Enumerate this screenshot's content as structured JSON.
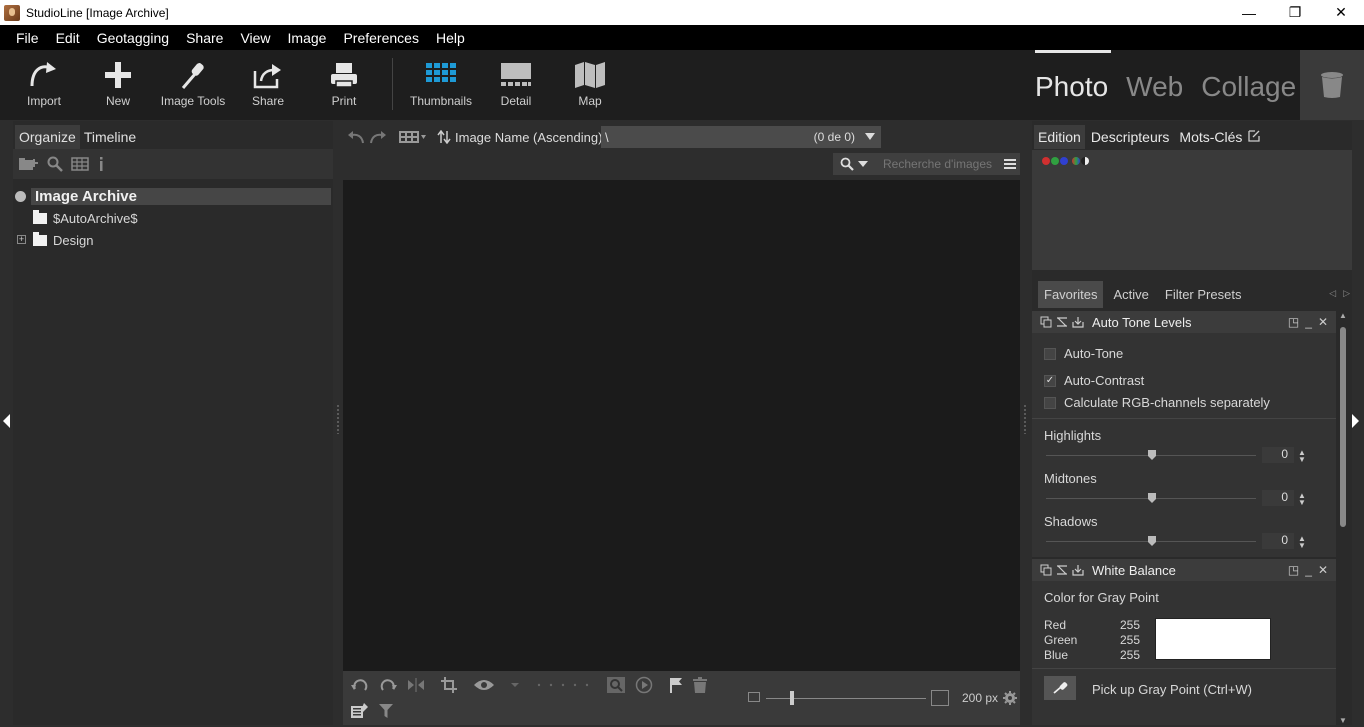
{
  "window": {
    "title": "StudioLine [Image Archive]",
    "minimize": "—",
    "maximize": "❐",
    "close": "✕"
  },
  "menu": [
    "File",
    "Edit",
    "Geotagging",
    "Share",
    "View",
    "Image",
    "Preferences",
    "Help"
  ],
  "toolbar": {
    "import": "Import",
    "new": "New",
    "image_tools": "Image Tools",
    "share": "Share",
    "print": "Print",
    "thumbnails": "Thumbnails",
    "detail": "Detail",
    "map": "Map"
  },
  "modes": {
    "photo": "Photo",
    "web": "Web",
    "collage": "Collage"
  },
  "left_panel": {
    "tabs": [
      "Organize",
      "Timeline"
    ],
    "tree": {
      "root": "Image Archive",
      "children": [
        "$AutoArchive$",
        "Design"
      ]
    }
  },
  "center": {
    "sort": "Image Name (Ascending)",
    "path": "\\",
    "count": "(0 de 0)",
    "search_placeholder": "Recherche d'images",
    "zoom": "200 px"
  },
  "right_panel": {
    "tabs": [
      "Edition",
      "Descripteurs",
      "Mots-Clés"
    ],
    "filter_tabs": [
      "Favorites",
      "Active",
      "Filter Presets"
    ],
    "auto_tone": {
      "title": "Auto Tone Levels",
      "auto_tone": "Auto-Tone",
      "auto_contrast": "Auto-Contrast",
      "rgb_separately": "Calculate RGB-channels separately",
      "highlights": "Highlights",
      "highlights_value": "0",
      "midtones": "Midtones",
      "midtones_value": "0",
      "shadows": "Shadows",
      "shadows_value": "0"
    },
    "white_balance": {
      "title": "White Balance",
      "gray_point_label": "Color for Gray Point",
      "red_label": "Red",
      "red_value": "255",
      "green_label": "Green",
      "green_value": "255",
      "blue_label": "Blue",
      "blue_value": "255",
      "pick_label": "Pick up Gray Point (Ctrl+W)"
    }
  },
  "colors": {
    "accent": "#1e9ad6",
    "toolbar_bg": "#1e1e1e",
    "image_area": "#1b1b1b"
  }
}
